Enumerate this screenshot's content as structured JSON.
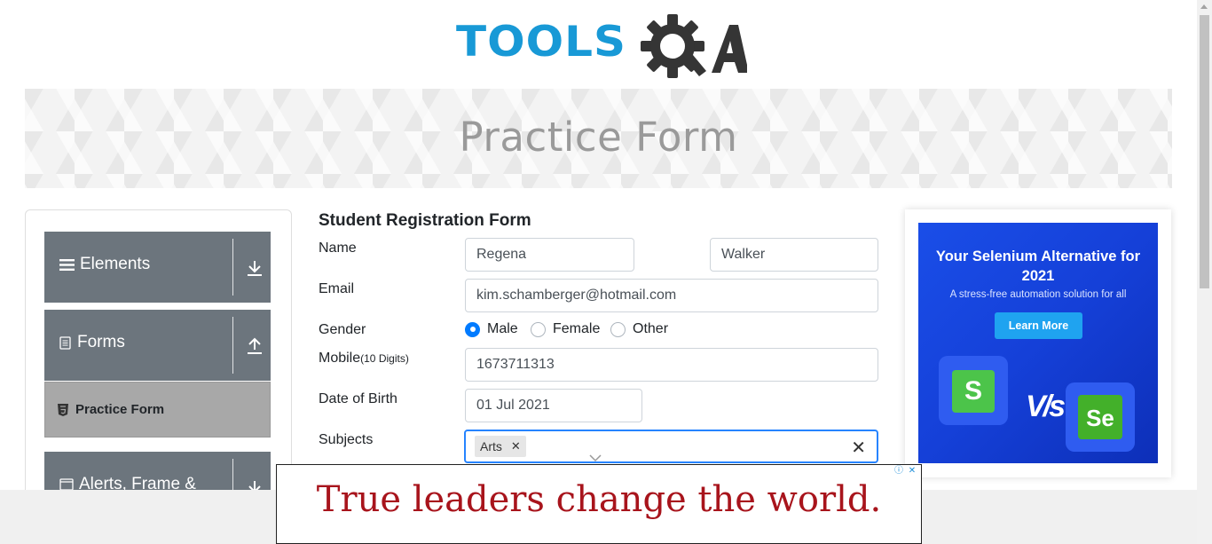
{
  "logo": {
    "left_text": "TOOLS",
    "right_text": "QA"
  },
  "banner": {
    "title": "Practice Form"
  },
  "sidebar": {
    "groups": [
      {
        "label": "Elements",
        "icon": "list-icon",
        "arrow": "download-arrow-icon"
      },
      {
        "label": "Forms",
        "icon": "document-icon",
        "arrow": "upload-arrow-icon"
      },
      {
        "label": "Alerts, Frame &",
        "icon": "window-icon",
        "arrow": "download-arrow-icon"
      }
    ],
    "active_item": {
      "label": "Practice Form",
      "icon": "html5-icon"
    }
  },
  "form": {
    "title": "Student Registration Form",
    "labels": {
      "name": "Name",
      "email": "Email",
      "gender": "Gender",
      "mobile": "Mobile",
      "mobile_hint": "(10 Digits)",
      "dob": "Date of Birth",
      "subjects": "Subjects"
    },
    "first_name": "Regena",
    "last_name": "Walker",
    "email": "kim.schamberger@hotmail.com",
    "gender_options": [
      "Male",
      "Female",
      "Other"
    ],
    "gender_selected": "Male",
    "mobile": "1673711313",
    "dob": "01 Jul 2021",
    "subjects": [
      "Arts"
    ]
  },
  "ad_right": {
    "headline": "Your Selenium Alternative for 2021",
    "subline": "A stress-free automation solution for all",
    "cta": "Learn More",
    "versus": "V/s",
    "left_logo": "S",
    "right_logo": "Se"
  },
  "ad_bottom": {
    "text": "True leaders change the world."
  },
  "colors": {
    "accent": "#007bff",
    "sidebar_group": "#6c757d",
    "logo_blue": "#1899d6",
    "ad_red": "#a8141c"
  }
}
